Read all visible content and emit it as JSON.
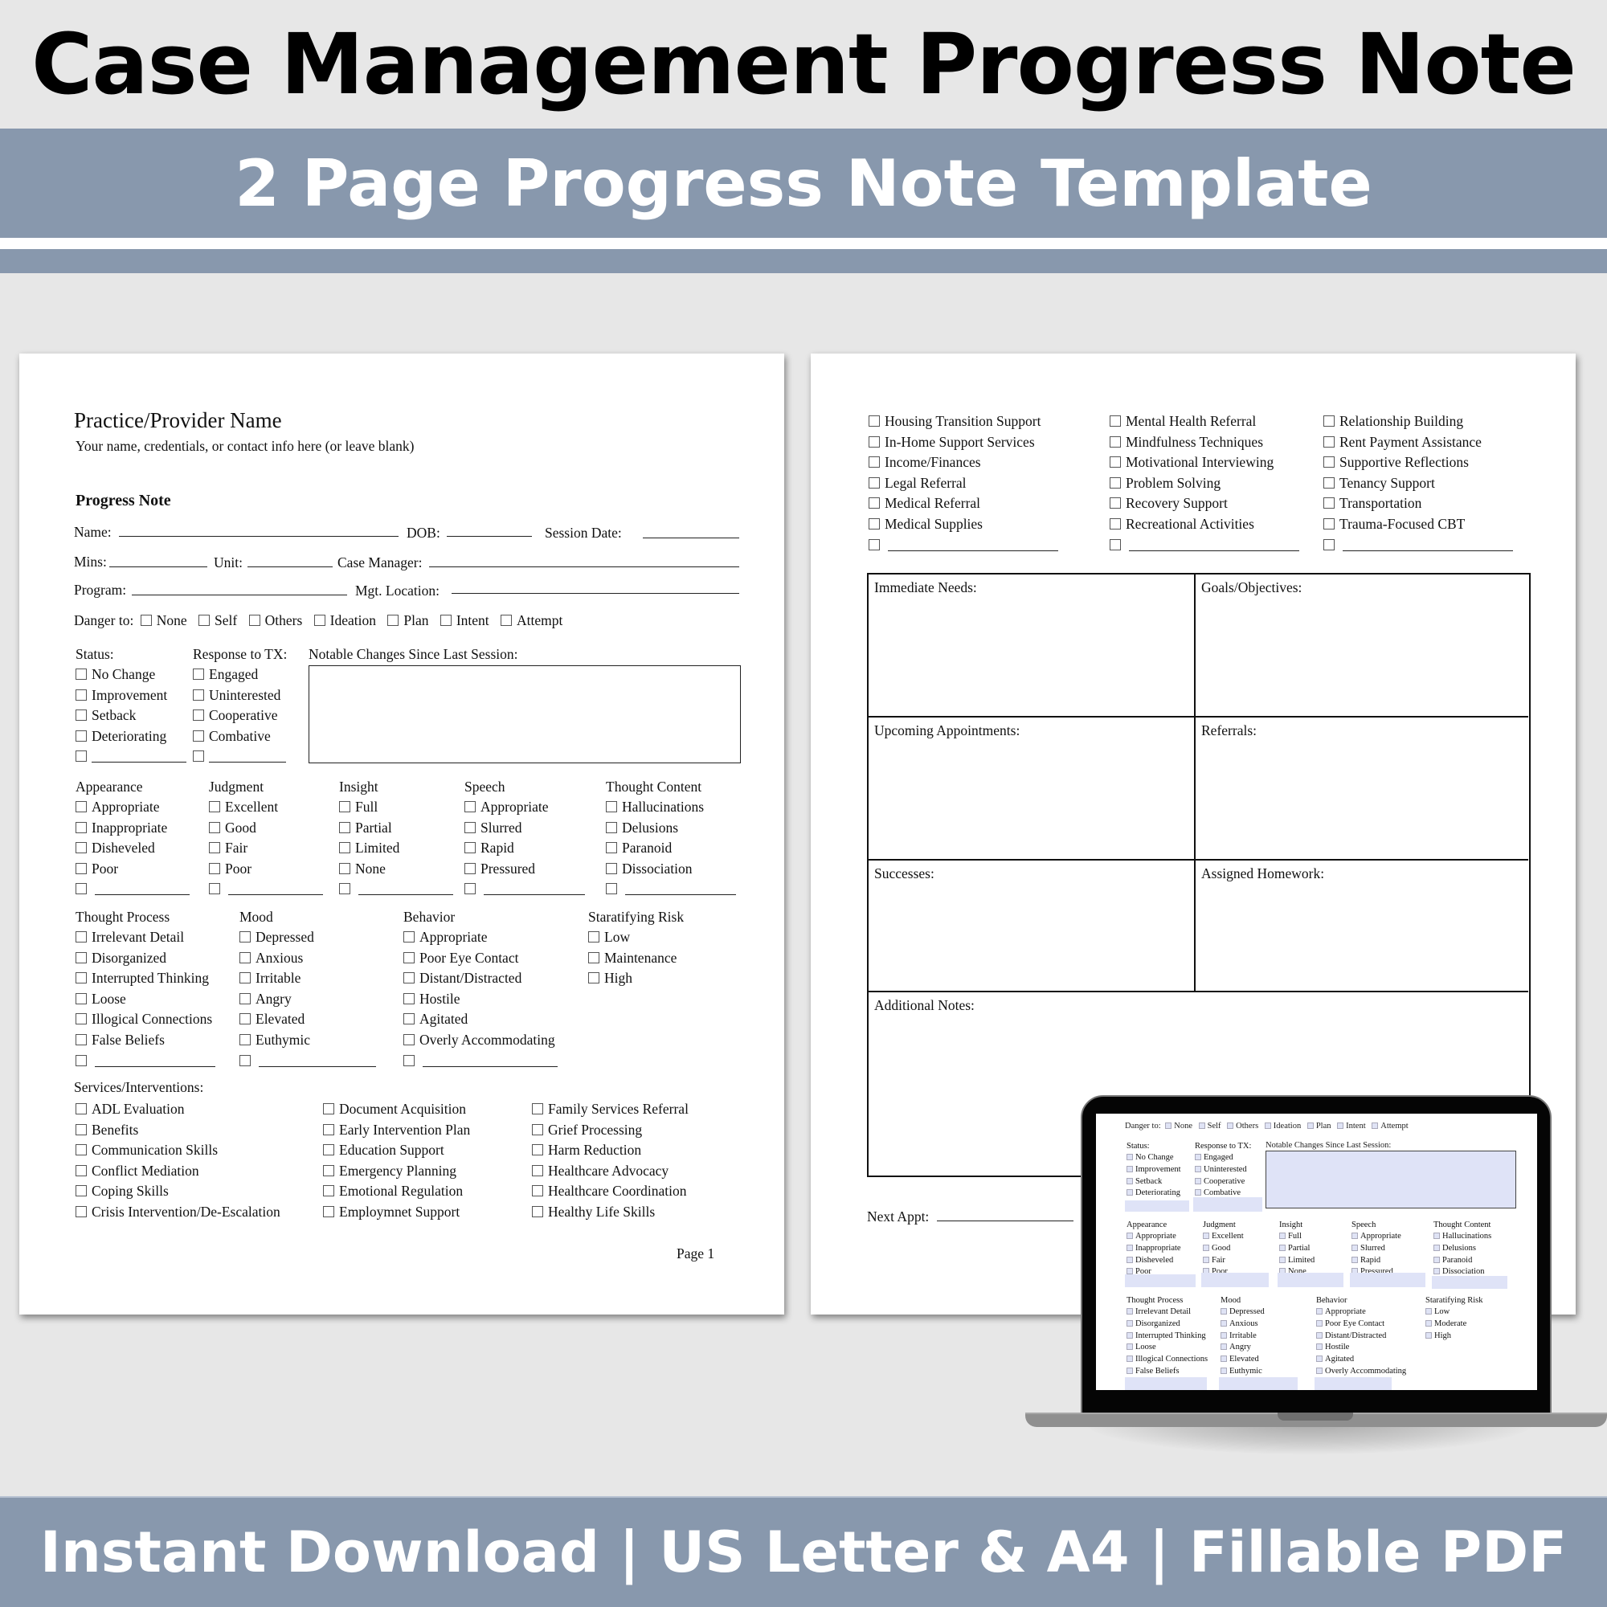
{
  "banner": {
    "title": "Case Management Progress Note",
    "subtitle": "2 Page Progress Note Template",
    "footer": "Instant Download | US Letter & A4 | Fillable PDF",
    "accent_color": "#8898ad"
  },
  "page1": {
    "provider_name": "Practice/Provider Name",
    "provider_sub": "Your name, credentials, or contact info here (or leave blank)",
    "section_title": "Progress Note",
    "fields": {
      "name": "Name:",
      "dob": "DOB:",
      "session_date": "Session Date:",
      "mins": "Mins:",
      "unit": "Unit:",
      "case_manager": "Case Manager:",
      "program": "Program:",
      "mgt_location": "Mgt. Location:"
    },
    "danger": {
      "label": "Danger to:",
      "options": [
        "None",
        "Self",
        "Others",
        "Ideation",
        "Plan",
        "Intent",
        "Attempt"
      ]
    },
    "status": {
      "title": "Status:",
      "options": [
        "No Change",
        "Improvement",
        "Setback",
        "Deteriorating"
      ]
    },
    "response": {
      "title": "Response to TX:",
      "options": [
        "Engaged",
        "Uninterested",
        "Cooperative",
        "Combative"
      ]
    },
    "notable_changes_label": "Notable Changes Since Last Session:",
    "mse_row1": [
      {
        "title": "Appearance",
        "options": [
          "Appropriate",
          "Inappropriate",
          "Disheveled",
          "Poor"
        ]
      },
      {
        "title": "Judgment",
        "options": [
          "Excellent",
          "Good",
          "Fair",
          "Poor"
        ]
      },
      {
        "title": "Insight",
        "options": [
          "Full",
          "Partial",
          "Limited",
          "None"
        ]
      },
      {
        "title": "Speech",
        "options": [
          "Appropriate",
          "Slurred",
          "Rapid",
          "Pressured"
        ]
      },
      {
        "title": "Thought Content",
        "options": [
          "Hallucinations",
          "Delusions",
          "Paranoid",
          "Dissociation"
        ]
      }
    ],
    "mse_row2": [
      {
        "title": "Thought Process",
        "options": [
          "Irrelevant Detail",
          "Disorganized",
          "Interrupted Thinking",
          "Loose",
          "Illogical Connections",
          "False Beliefs"
        ]
      },
      {
        "title": "Mood",
        "options": [
          "Depressed",
          "Anxious",
          "Irritable",
          "Angry",
          "Elevated",
          "Euthymic"
        ]
      },
      {
        "title": "Behavior",
        "options": [
          "Appropriate",
          "Poor Eye Contact",
          "Distant/Distracted",
          "Hostile",
          "Agitated",
          "Overly Accommodating"
        ]
      },
      {
        "title": "Staratifying Risk",
        "options": [
          "Low",
          "Maintenance",
          "High"
        ]
      }
    ],
    "services": {
      "title": "Services/Interventions:",
      "columns": [
        [
          "ADL Evaluation",
          "Benefits",
          "Communication Skills",
          "Conflict Mediation",
          "Coping Skills",
          "Crisis Intervention/De-Escalation"
        ],
        [
          "Document Acquisition",
          "Early Intervention Plan",
          "Education Support",
          "Emergency Planning",
          "Emotional Regulation",
          "Employmnet Support"
        ],
        [
          "Family Services Referral",
          "Grief Processing",
          "Harm Reduction",
          "Healthcare Advocacy",
          "Healthcare Coordination",
          "Healthy Life Skills"
        ]
      ]
    },
    "page_number": "Page 1"
  },
  "page2": {
    "services_columns": [
      [
        "Housing Transition Support",
        "In-Home Support Services",
        "Income/Finances",
        "Legal Referral",
        "Medical Referral",
        "Medical Supplies"
      ],
      [
        "Mental Health Referral",
        "Mindfulness Techniques",
        "Motivational Interviewing",
        "Problem Solving",
        "Recovery Support",
        "Recreational Activities"
      ],
      [
        "Relationship Building",
        "Rent Payment Assistance",
        "Supportive Reflections",
        "Tenancy Support",
        "Transportation",
        "Trauma-Focused CBT"
      ]
    ],
    "boxes": {
      "immediate_needs": "Immediate Needs:",
      "goals": "Goals/Objectives:",
      "upcoming": "Upcoming Appointments:",
      "referrals": "Referrals:",
      "successes": "Successes:",
      "homework": "Assigned Homework:",
      "additional": "Additional Notes:"
    },
    "next_appt": "Next Appt:"
  },
  "laptop": {
    "danger_label": "Danger to:",
    "danger_options": [
      "None",
      "Self",
      "Others",
      "Ideation",
      "Plan",
      "Intent",
      "Attempt"
    ],
    "status": {
      "title": "Status:",
      "options": [
        "No Change",
        "Improvement",
        "Setback",
        "Deteriorating"
      ]
    },
    "response": {
      "title": "Response to TX:",
      "options": [
        "Engaged",
        "Uninterested",
        "Cooperative",
        "Combative"
      ]
    },
    "notable_label": "Notable Changes Since Last Session:",
    "mse_row1": [
      {
        "title": "Appearance",
        "options": [
          "Appropriate",
          "Inappropriate",
          "Disheveled",
          "Poor"
        ]
      },
      {
        "title": "Judgment",
        "options": [
          "Excellent",
          "Good",
          "Fair",
          "Poor"
        ]
      },
      {
        "title": "Insight",
        "options": [
          "Full",
          "Partial",
          "Limited",
          "None"
        ]
      },
      {
        "title": "Speech",
        "options": [
          "Appropriate",
          "Slurred",
          "Rapid",
          "Pressured"
        ]
      },
      {
        "title": "Thought Content",
        "options": [
          "Hallucinations",
          "Delusions",
          "Paranoid",
          "Dissociation"
        ]
      }
    ],
    "mse_row2": [
      {
        "title": "Thought Process",
        "options": [
          "Irrelevant Detail",
          "Disorganized",
          "Interrupted Thinking",
          "Loose",
          "Illogical Connections",
          "False Beliefs"
        ]
      },
      {
        "title": "Mood",
        "options": [
          "Depressed",
          "Anxious",
          "Irritable",
          "Angry",
          "Elevated",
          "Euthymic"
        ]
      },
      {
        "title": "Behavior",
        "options": [
          "Appropriate",
          "Poor Eye Contact",
          "Distant/Distracted",
          "Hostile",
          "Agitated",
          "Overly Accommodating"
        ]
      },
      {
        "title": "Staratifying Risk",
        "options": [
          "Low",
          "Moderate",
          "High"
        ]
      }
    ],
    "field_fill_color": "#dfe3f7"
  }
}
